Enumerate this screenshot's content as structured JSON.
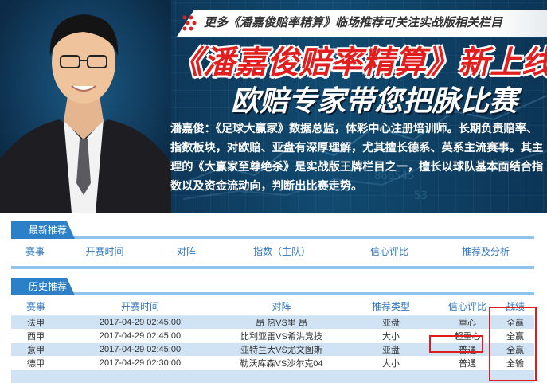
{
  "banner": {
    "top_strip": "更多《潘嘉俊赔率精算》临场推荐可关注实战版相关栏目",
    "title": "《潘嘉俊赔率精算》新上线",
    "subtitle": "欧赔专家带您把脉比赛",
    "description": "潘嘉俊：《足球大赢家》数据总监，体彩中心注册培训师。长期负责赔率、指数板块，对欧赔、亚盘有深厚理解，尤其擅长德系、英系主流赛事。其主理的《大赢家至尊绝杀》是实战版王牌栏目之一，擅长以球队基本面结合指数以及资金流动向，判断出比赛走势。",
    "photo_icon": "person-portrait",
    "colors": {
      "title_red": "#e21f1f",
      "banner_blue": "#0e3a5c"
    }
  },
  "latest": {
    "tab_label": "最新推荐",
    "columns": [
      "赛事",
      "开赛时间",
      "对阵",
      "指数（主队）",
      "信心评比",
      "推荐及分析"
    ]
  },
  "history": {
    "tab_label": "历史推荐",
    "columns": [
      "赛事",
      "开赛时间",
      "对阵",
      "推荐类型",
      "信心评比",
      "战绩"
    ],
    "rows": [
      {
        "league": "法甲",
        "time": "2017-04-29 02:45:00",
        "match": "昂 热VS里 昂",
        "type": "亚盘",
        "confidence": "重心",
        "result": "全赢"
      },
      {
        "league": "西甲",
        "time": "2017-04-29 02:45:00",
        "match": "比利亚雷VS希洪竞技",
        "type": "大小",
        "confidence": "超重心",
        "result": "全赢"
      },
      {
        "league": "意甲",
        "time": "2017-04-29 02:45:00",
        "match": "亚特兰大VS尤文图斯",
        "type": "亚盘",
        "confidence": "普通",
        "result": "全赢"
      },
      {
        "league": "德甲",
        "time": "2017-04-29 02:30:00",
        "match": "勒沃库森VS沙尔克04",
        "type": "大小",
        "confidence": "普通",
        "result": "全输"
      },
      {
        "league": "",
        "time": "",
        "match": "",
        "type": "",
        "confidence": "",
        "result": ""
      }
    ],
    "highlight_color": "#e01c1c"
  }
}
